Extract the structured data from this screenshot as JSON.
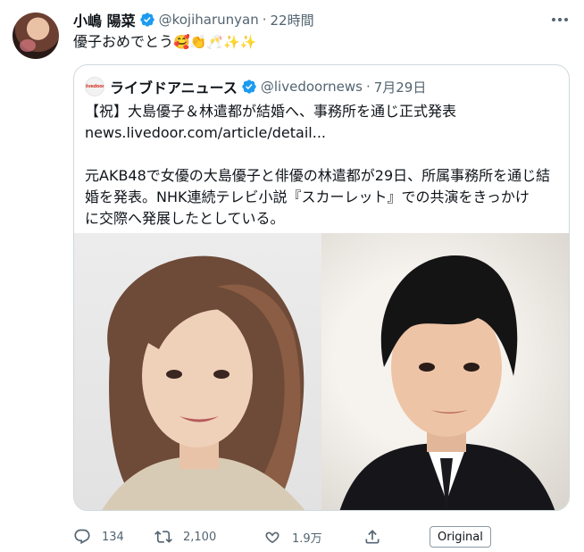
{
  "author": {
    "display_name": "小嶋 陽菜",
    "handle": "@kojiharunyan",
    "separator": "·",
    "time": "22時間"
  },
  "tweet": {
    "text": "優子おめでとう",
    "emojis": "🥰👏🥂✨✨"
  },
  "quote": {
    "logo_text": "livedoor",
    "name": "ライブドアニュース",
    "handle": "@livedoornews",
    "separator": "·",
    "date": "7月29日",
    "title": "【祝】大島優子＆林遣都が結婚へ、事務所を通じ正式発表",
    "link": "news.livedoor.com/article/detail...",
    "body_lines": [
      "元AKB48で女優の大島優子と俳優の林遣都が29日、所属事務所を通じ結",
      "婚を発表。NHK連続テレビ小説『スカーレット』での共演をきっかけ",
      "に交際へ発展したとしている。"
    ]
  },
  "actions": {
    "reply_count": "134",
    "retweet_count": "2,100",
    "like_count": "1.9万",
    "original_label": "Original"
  },
  "icons": {
    "verified": "verified-badge-icon",
    "more": "more-options-icon",
    "reply": "reply-icon",
    "retweet": "retweet-icon",
    "like": "heart-icon",
    "share": "share-icon"
  },
  "colors": {
    "verified": "#1d9bf0",
    "secondary_text": "#536471",
    "border": "#cfd9de",
    "logo_red": "#d53a2c"
  }
}
